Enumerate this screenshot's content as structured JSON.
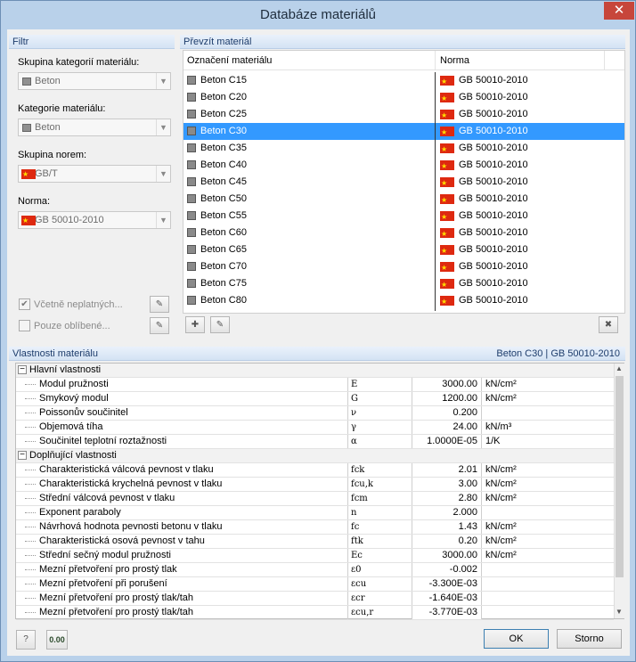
{
  "window": {
    "title": "Databáze materiálů",
    "close": "✕"
  },
  "filter": {
    "header": "Filtr",
    "group_label": "Skupina kategorií materiálu:",
    "group_value": "Beton",
    "category_label": "Kategorie materiálu:",
    "category_value": "Beton",
    "norm_group_label": "Skupina norem:",
    "norm_group_value": "GB/T",
    "norm_label": "Norma:",
    "norm_value": "GB 50010-2010",
    "include_invalid": "Včetně neplatných...",
    "favorites_only": "Pouze oblíbené..."
  },
  "take": {
    "header": "Převzít materiál",
    "col_name": "Označení materiálu",
    "col_norm": "Norma",
    "rows": [
      {
        "name": "Beton C15",
        "norm": "GB 50010-2010"
      },
      {
        "name": "Beton C20",
        "norm": "GB 50010-2010"
      },
      {
        "name": "Beton C25",
        "norm": "GB 50010-2010"
      },
      {
        "name": "Beton C30",
        "norm": "GB 50010-2010"
      },
      {
        "name": "Beton C35",
        "norm": "GB 50010-2010"
      },
      {
        "name": "Beton C40",
        "norm": "GB 50010-2010"
      },
      {
        "name": "Beton C45",
        "norm": "GB 50010-2010"
      },
      {
        "name": "Beton C50",
        "norm": "GB 50010-2010"
      },
      {
        "name": "Beton C55",
        "norm": "GB 50010-2010"
      },
      {
        "name": "Beton C60",
        "norm": "GB 50010-2010"
      },
      {
        "name": "Beton C65",
        "norm": "GB 50010-2010"
      },
      {
        "name": "Beton C70",
        "norm": "GB 50010-2010"
      },
      {
        "name": "Beton C75",
        "norm": "GB 50010-2010"
      },
      {
        "name": "Beton C80",
        "norm": "GB 50010-2010"
      }
    ],
    "selected_index": 3
  },
  "properties": {
    "header": "Vlastnosti materiálu",
    "selected": "Beton C30  |  GB 50010-2010",
    "groups": [
      {
        "title": "Hlavní vlastnosti",
        "rows": [
          {
            "name": "Modul pružnosti",
            "sym": "E",
            "val": "3000.00",
            "unit": "kN/cm²"
          },
          {
            "name": "Smykový modul",
            "sym": "G",
            "val": "1200.00",
            "unit": "kN/cm²"
          },
          {
            "name": "Poissonův součinitel",
            "sym": "ν",
            "val": "0.200",
            "unit": ""
          },
          {
            "name": "Objemová tíha",
            "sym": "γ",
            "val": "24.00",
            "unit": "kN/m³"
          },
          {
            "name": "Součinitel teplotní roztažnosti",
            "sym": "α",
            "val": "1.0000E-05",
            "unit": "1/K"
          }
        ]
      },
      {
        "title": "Doplňující vlastnosti",
        "rows": [
          {
            "name": "Charakteristická válcová pevnost v tlaku",
            "sym": "fck",
            "val": "2.01",
            "unit": "kN/cm²"
          },
          {
            "name": "Charakteristická krychelná pevnost v tlaku",
            "sym": "fcu,k",
            "val": "3.00",
            "unit": "kN/cm²"
          },
          {
            "name": "Střední válcová pevnost v tlaku",
            "sym": "fcm",
            "val": "2.80",
            "unit": "kN/cm²"
          },
          {
            "name": "Exponent paraboly",
            "sym": "n",
            "val": "2.000",
            "unit": ""
          },
          {
            "name": "Návrhová hodnota pevnosti betonu v tlaku",
            "sym": "fc",
            "val": "1.43",
            "unit": "kN/cm²"
          },
          {
            "name": "Charakteristická osová pevnost v tahu",
            "sym": "ftk",
            "val": "0.20",
            "unit": "kN/cm²"
          },
          {
            "name": "Střední sečný modul pružnosti",
            "sym": "Ec",
            "val": "3000.00",
            "unit": "kN/cm²"
          },
          {
            "name": "Mezní přetvoření pro prostý tlak",
            "sym": "ε0",
            "val": "-0.002",
            "unit": ""
          },
          {
            "name": "Mezní přetvoření při porušení",
            "sym": "εcu",
            "val": "-3.300E-03",
            "unit": ""
          },
          {
            "name": "Mezní přetvoření pro prostý tlak/tah",
            "sym": "εcr",
            "val": "-1.640E-03",
            "unit": ""
          },
          {
            "name": "Mezní přetvoření pro prostý tlak/tah",
            "sym": "εcu,r",
            "val": "-3.770E-03",
            "unit": ""
          }
        ]
      }
    ]
  },
  "footer": {
    "help_icon": "?",
    "units_icon": "0.00",
    "ok": "OK",
    "cancel": "Storno"
  }
}
